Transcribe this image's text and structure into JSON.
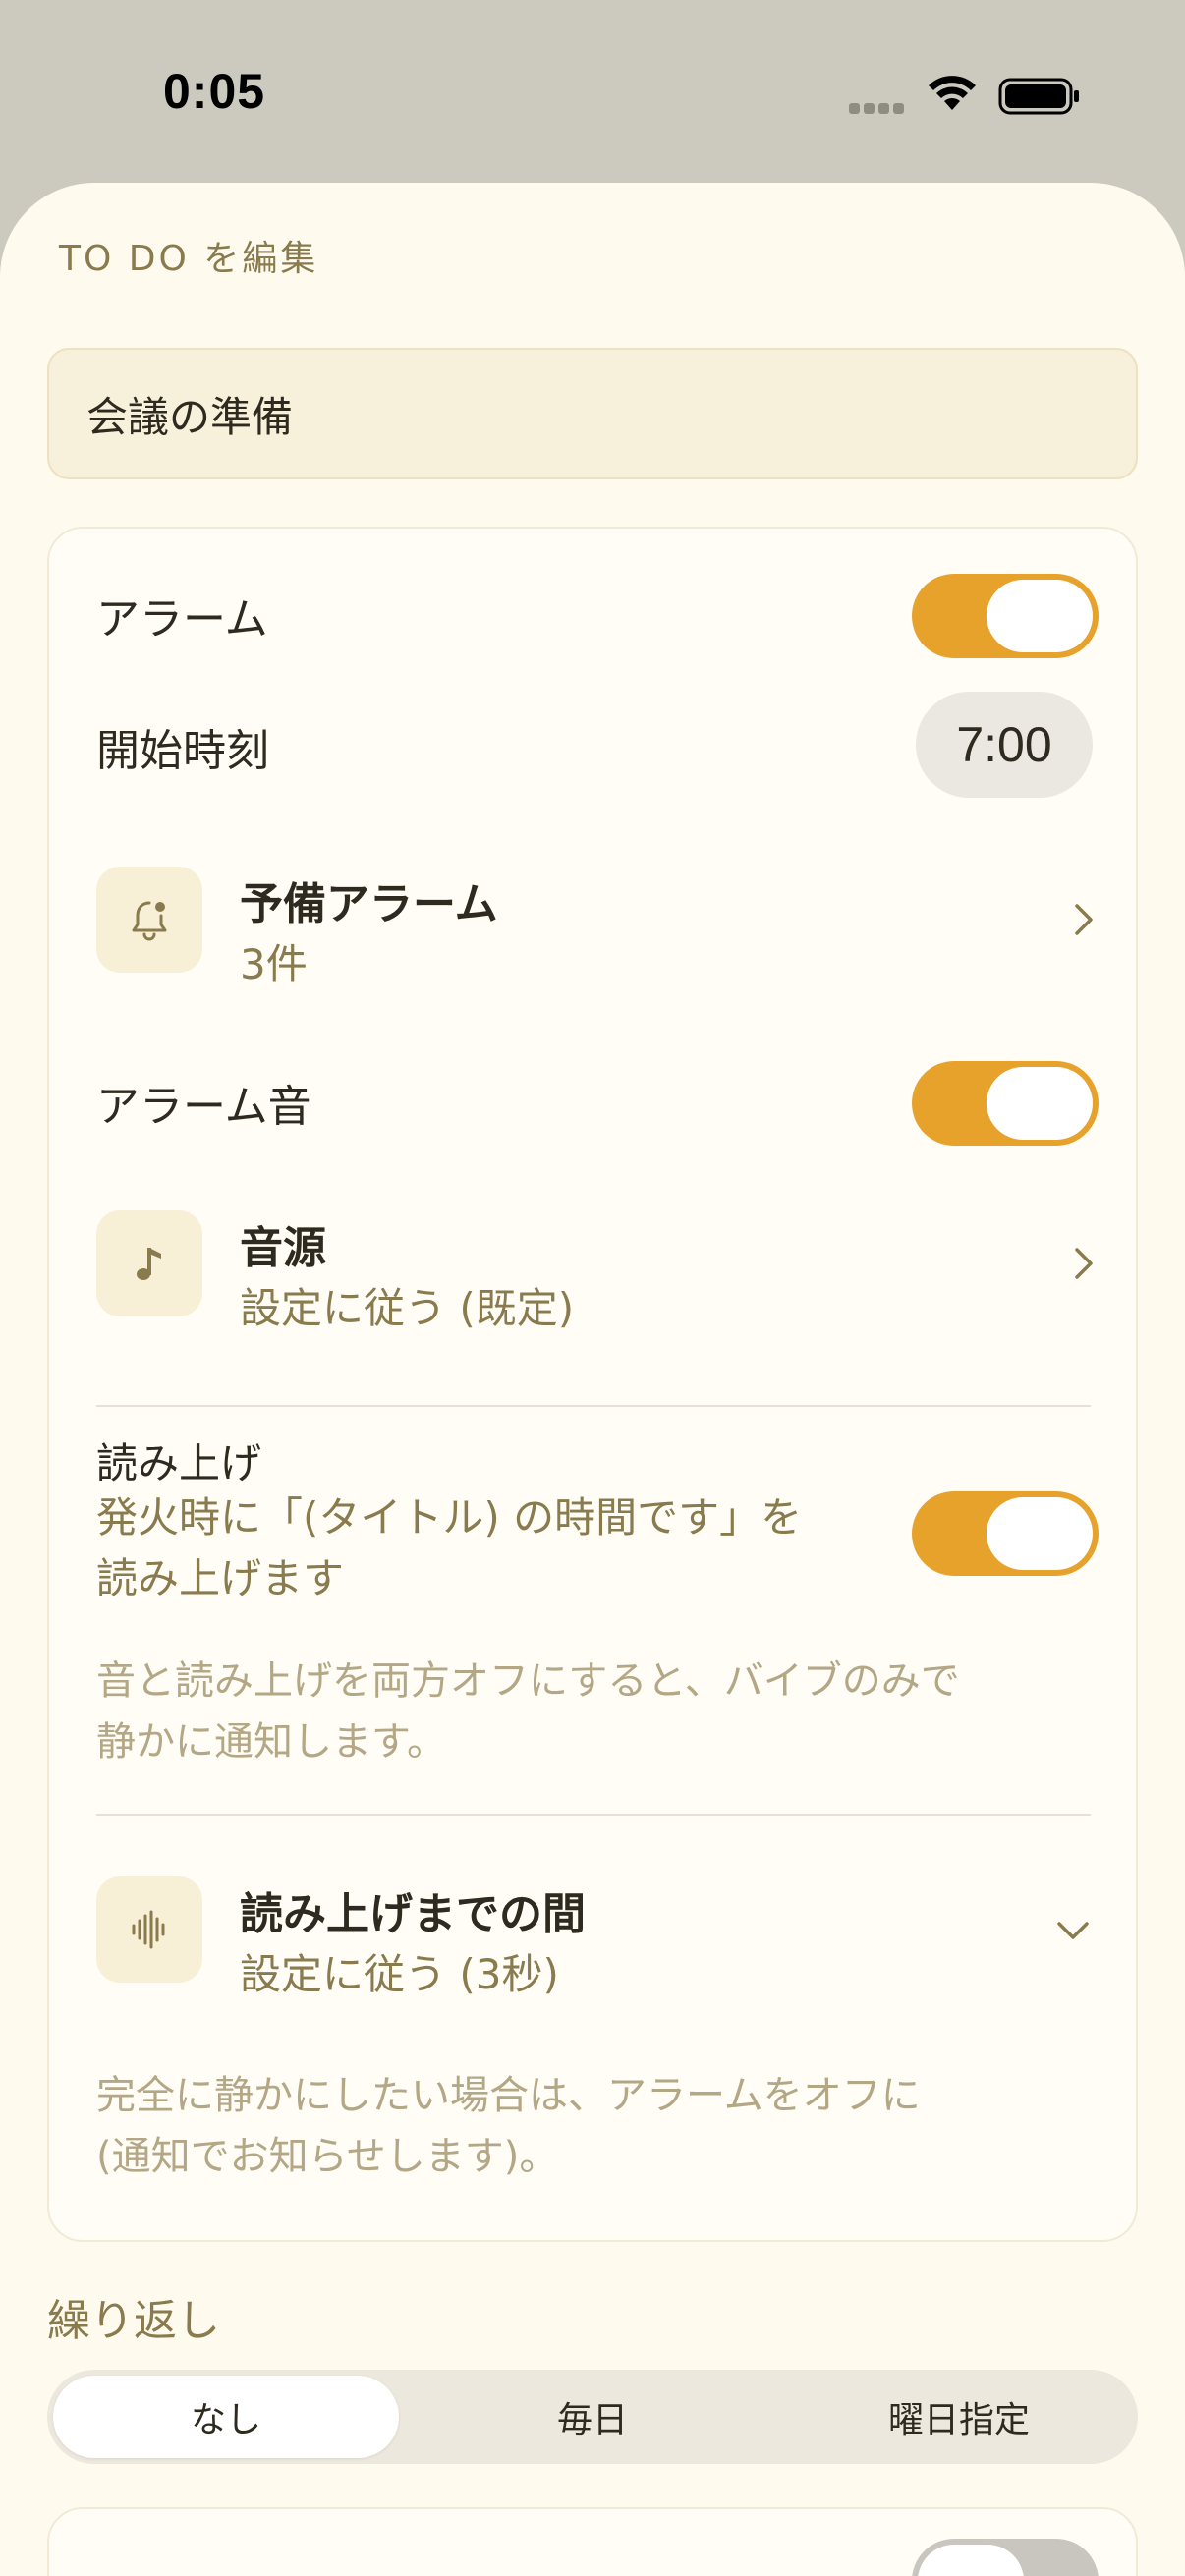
{
  "status_bar": {
    "time": "0:05"
  },
  "sheet": {
    "title": "TO DO を編集"
  },
  "task": {
    "title": "会議の準備"
  },
  "alarm": {
    "label": "アラーム",
    "enabled": true,
    "start_time_label": "開始時刻",
    "start_time": "7:00",
    "backup": {
      "title": "予備アラーム",
      "subtitle": "3件"
    },
    "sound_label": "アラーム音",
    "sound_enabled": true,
    "source": {
      "title": "音源",
      "subtitle": "設定に従う (既定)"
    },
    "readout": {
      "title": "読み上げ",
      "desc_line1": "発火時に「(タイトル) の時間です」を",
      "desc_line2": "読み上げます",
      "enabled": true
    },
    "vibe_hint_line1": "音と読み上げを両方オフにすると、バイブのみで",
    "vibe_hint_line2": "静かに通知します。",
    "delay": {
      "title": "読み上げまでの間",
      "subtitle": "設定に従う (3秒)"
    },
    "silent_hint_line1": "完全に静かにしたい場合は、アラームをオフに",
    "silent_hint_line2": "(通知でお知らせします)。"
  },
  "repeat": {
    "label": "繰り返し",
    "options": [
      "なし",
      "毎日",
      "曜日指定"
    ],
    "selected": "なし"
  },
  "colors": {
    "accent": "#e6a22a",
    "sheet_bg": "#fefbee",
    "muted_text": "#8a7b4e",
    "hint_text": "#b4a785"
  },
  "icons": {
    "backup": "bell-badge-icon",
    "source": "music-note-icon",
    "delay": "waveform-icon"
  }
}
